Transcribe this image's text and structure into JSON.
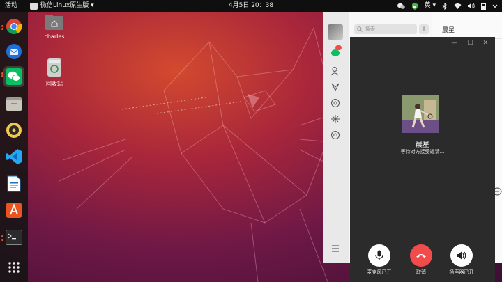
{
  "topbar": {
    "activities": "活动",
    "app_menu": "微信Linux原生版 ▾",
    "clock": "4月5日  20：38",
    "input_method": "英 ▾"
  },
  "desktop": {
    "icons": [
      {
        "label": "charles"
      },
      {
        "label": "回收站"
      }
    ]
  },
  "dock": {
    "items": [
      "chrome-icon",
      "thunderbird-icon",
      "wechat-icon",
      "files-icon",
      "rhythmbox-icon",
      "vscode-icon",
      "writer-icon",
      "software-center-icon",
      "terminal-icon",
      "show-apps-icon"
    ]
  },
  "wechat": {
    "search_placeholder": "搜索",
    "add_label": "+",
    "chat_name": "晨星",
    "badge": "···"
  },
  "call": {
    "name": "晨星",
    "status": "等待对方接受邀请...",
    "mic_label": "麦克风已开",
    "cancel_label": "取消",
    "speaker_label": "扬声器已开",
    "window_buttons": [
      "—",
      "☐",
      "✕"
    ]
  },
  "colors": {
    "accent_orange": "#e95420",
    "hangup_red": "#f24b4b",
    "wechat_green": "#07c160"
  }
}
